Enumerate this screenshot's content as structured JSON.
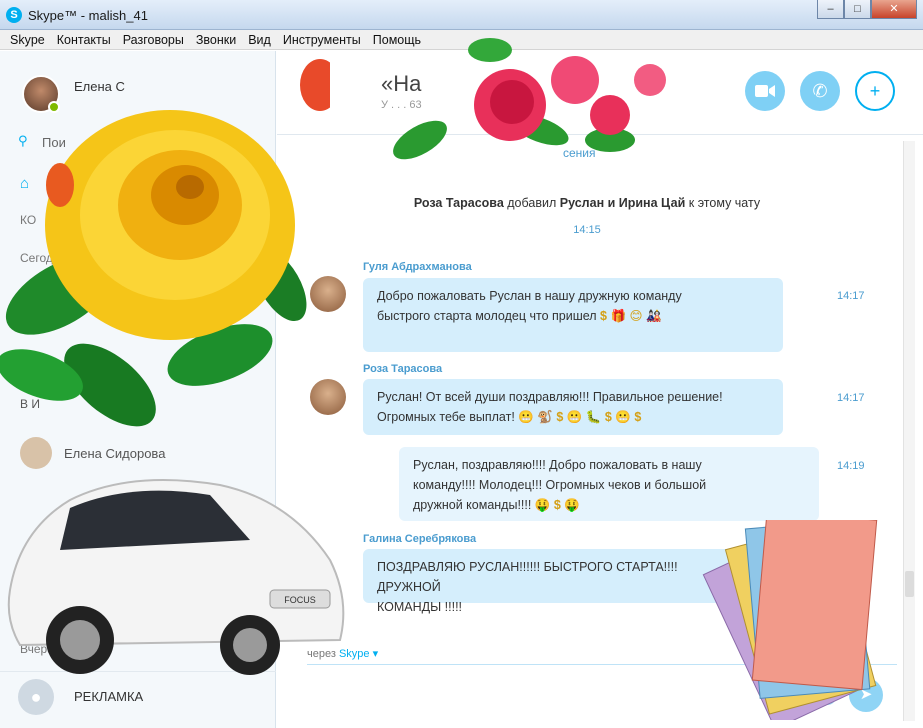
{
  "window": {
    "title": "Skype™ - malish_41",
    "minimize": "‒",
    "maximize": "□",
    "close": "✕"
  },
  "menu": [
    "Skype",
    "Контакты",
    "Разговоры",
    "Звонки",
    "Вид",
    "Инструменты",
    "Помощь"
  ],
  "profile": {
    "name": "Елена С"
  },
  "sidebar": {
    "search_label": "Пои",
    "section_top": "КО",
    "section_today": "Сегодн",
    "contacts": [
      {
        "name": "Елена Сидорова"
      }
    ],
    "partial_text": "В И",
    "section_yesterday": "Вчерашние",
    "ad_label": "РЕКЛАМКА"
  },
  "chat": {
    "title": "«На",
    "subtitle": "У . . . 63",
    "history_link": "сения",
    "system_message": {
      "actor": "Роза Тарасова",
      "action": "добавил",
      "targets": "Руслан и Ирина Цай",
      "tail": "к этому чату"
    },
    "system_time": "14:15",
    "messages": [
      {
        "sender": "Гуля Абдрахманова",
        "text_1": "Добро пожаловать Руслан в нашу дружную команду",
        "text_2": "быстрого старта молодец что пришел",
        "emoji": "$ 🎁 😊 🎎",
        "time": "14:17"
      },
      {
        "sender": "Роза Тарасова",
        "text_1": "Руслан! От всей души поздравляю!!! Правильное решение!",
        "text_2": "Огромных тебе выплат!",
        "emoji": "😬 🐒 $ 😬 🐛 $ 😬 $",
        "time": "14:17"
      },
      {
        "sender": "",
        "text_1": "Руслан, поздравляю!!!! Добро пожаловать в нашу",
        "text_2": "команду!!!! Молодец!!! Огромных чеков и большой",
        "text_3": "дружной команды!!!!",
        "emoji": "🤑 $ 🤑",
        "time": "14:19"
      },
      {
        "sender": "Галина Серебрякова",
        "text_1": "ПОЗДРАВЛЯЮ РУСЛАН!!!!!! БЫСТРОГО СТАРТА!!!!ДРУЖНОЙ",
        "text_2": "КОМАНДЫ !!!!!"
      }
    ],
    "composer_via_prefix": "через",
    "composer_via_link": "Skype ▾"
  },
  "colors": {
    "skype_blue": "#00aff0",
    "bubble_bg": "#d5eefc",
    "time_text": "#4a9ccf",
    "presence_green": "#7fba00"
  },
  "icons": {
    "video": "video-call-icon",
    "call": "phone-icon",
    "add": "add-contact-icon",
    "send": "send-icon"
  },
  "decorations": {
    "car_badge": "FOCUS"
  }
}
